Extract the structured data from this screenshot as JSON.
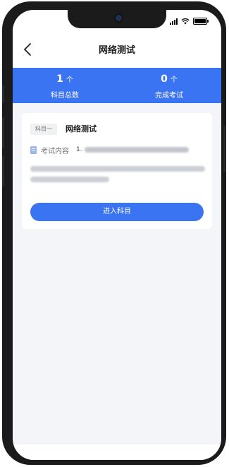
{
  "navbar": {
    "title": "网络测试",
    "back_icon": "chevron-left-icon"
  },
  "stats": [
    {
      "value": "1",
      "unit": "个",
      "label": "科目总数"
    },
    {
      "value": "0",
      "unit": "个",
      "label": "完成考试"
    }
  ],
  "card": {
    "tag": "科目一",
    "subject_name": "网络测试",
    "content_label": "考试内容",
    "content_value_prefix": "1.",
    "button_label": "进入科目"
  },
  "colors": {
    "accent": "#3b74f2",
    "background": "#f4f5f8"
  }
}
